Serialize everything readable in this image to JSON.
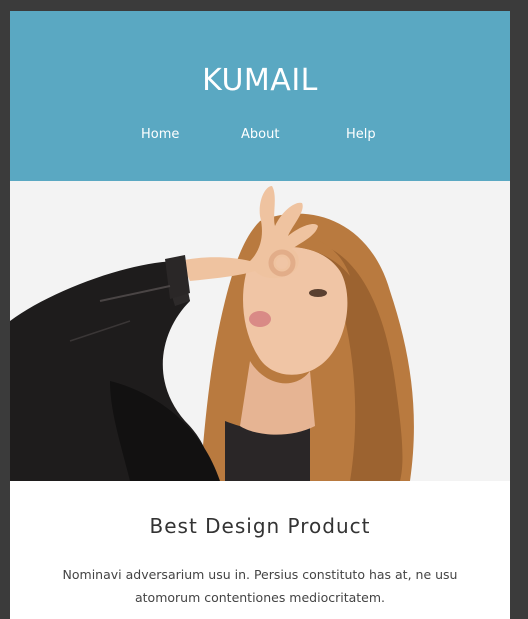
{
  "header": {
    "brand": "KUMAIL",
    "nav": [
      {
        "label": "Home"
      },
      {
        "label": "About"
      },
      {
        "label": "Help"
      }
    ]
  },
  "hero": {
    "image_subject": "woman-photo"
  },
  "content": {
    "title": "Best Design Product",
    "description": "Nominavi adversarium usu in. Persius constituto has at, ne usu atomorum contentiones mediocritatem."
  },
  "colors": {
    "page_background": "#3b3b3b",
    "header_background": "#5aa8c2",
    "hero_background": "#f3f3f3",
    "card_background": "#ffffff",
    "text_dark": "#333333"
  }
}
